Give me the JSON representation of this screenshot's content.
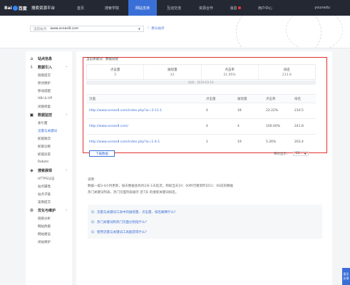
{
  "header": {
    "logo_text": "Bai",
    "logo_suffix": "百度",
    "product": "搜索资源平台",
    "nav": [
      {
        "label": "首页"
      },
      {
        "label": "搜索学院"
      },
      {
        "label": "网站支持"
      },
      {
        "label": "互动交流"
      },
      {
        "label": "资源合作"
      },
      {
        "label": "消息"
      },
      {
        "label": "用户中心"
      }
    ],
    "username": "younedu"
  },
  "site_bar": {
    "select_prefix": "当前站点:",
    "select_value": "www.ocean8.com",
    "default_site_label": "默认站点"
  },
  "sidebar": {
    "groups": [
      {
        "label": "站点信息",
        "items": []
      },
      {
        "label": "数据引入",
        "items": [
          "链接提交",
          "原创保护",
          "移动适配",
          "HBI & HP",
          "闭链修复"
        ]
      },
      {
        "label": "数据监控",
        "items": [
          "索引量",
          "流量与关键词",
          "抓取频次",
          "抓取诊断",
          "抓取异常",
          "Robots"
        ]
      },
      {
        "label": "搜索展现",
        "items": [
          "HTTPS认证",
          "站点属性",
          "站点子链",
          "案例提交"
        ]
      },
      {
        "label": "优化与维护",
        "items": [
          "链接分析",
          "网站改版",
          "网站建设",
          "闭站保护"
        ]
      }
    ]
  },
  "main": {
    "breadcrumb": "当前关键词：数据链接",
    "stats": [
      {
        "label": "点击量",
        "value": "5"
      },
      {
        "label": "展现量",
        "value": "41"
      },
      {
        "label": "点击率",
        "value": "21.95%"
      },
      {
        "label": "排名",
        "value": "213.6"
      }
    ],
    "time_label": "时间：2019-03-14",
    "table": {
      "headers": [
        "页面",
        "点击量",
        "展现量",
        "点击率",
        "排名"
      ],
      "rows": [
        {
          "url": "http://www.ocean8.com/index.php?ai=3-11-1",
          "clicks": "4",
          "impressions": "18",
          "ctr": "22.22%",
          "rank": "210.5"
        },
        {
          "url": "http://www.ocean8.com/",
          "clicks": "4",
          "impressions": "4",
          "ctr": "100.00%",
          "rank": "241.8"
        },
        {
          "url": "http://www.ocean8.com/index.php?ai=1-4-1",
          "clicks": "1",
          "impressions": "19",
          "ctr": "5.26%",
          "rank": "203.4"
        }
      ]
    },
    "download_label": "下载数据",
    "per_page_label": "每页显示：",
    "per_page_value": "10",
    "notes_title": "说明",
    "notes_lines": [
      "数据一般3-4小时更新，按天数据会有约2天-1天延迟。例如当天10：00时可看到昨日11：00前的数据",
      "热门关键词列表，热门页面列表展示 近7天 的搜索关键词排名。"
    ],
    "faq": [
      "Q：流量与关键词工具中的展现量、点击量、排名解释什么？",
      "Q：热门关键词和热门页面分别指什么？",
      "Q：使用流量与关键词工具能获得什么？"
    ]
  },
  "float_tab": "意见反馈"
}
